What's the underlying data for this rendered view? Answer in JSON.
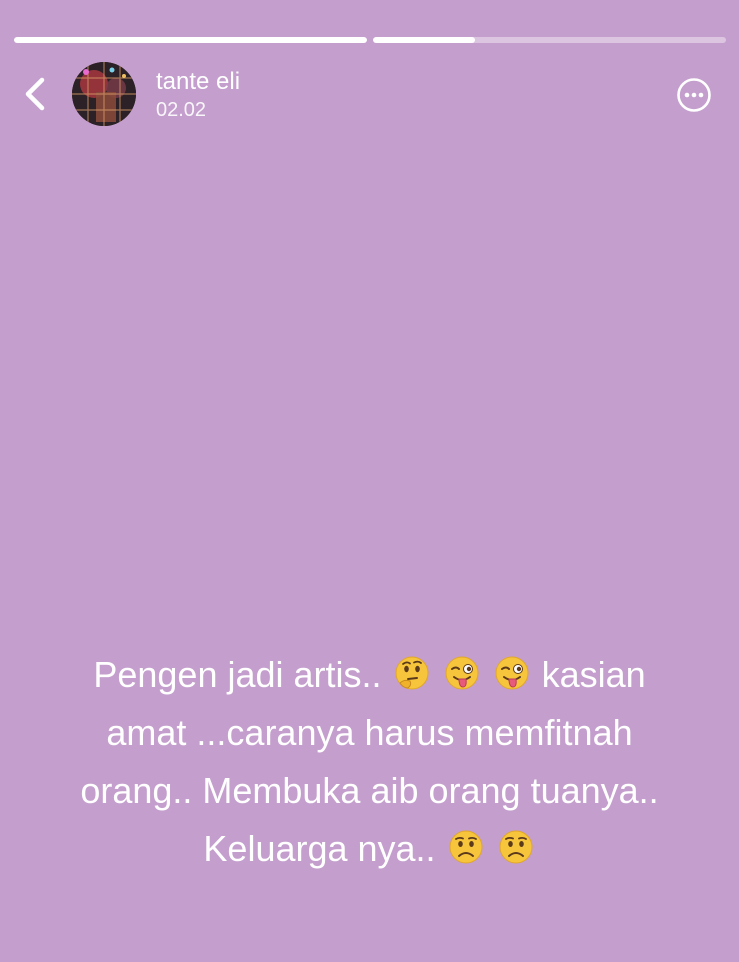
{
  "progress": [
    {
      "state": "complete",
      "fraction": 1.0
    },
    {
      "state": "active",
      "fraction": 0.29
    }
  ],
  "header": {
    "back_icon": "chevron-left-icon",
    "username": "tante eli",
    "timestamp": "02.02",
    "more_icon": "more-horizontal-circle-icon"
  },
  "story": {
    "line1_a": "Pengen jadi artis.. ",
    "line1_b": "kasian",
    "line2": "amat ...caranya harus memfitnah",
    "line3": "orang.. Membuka aib orang tuanya..",
    "line4": "Keluarga nya.. ",
    "emojis": [
      "thinking-face",
      "winking-tongue-face",
      "winking-tongue-face",
      "worried-face",
      "worried-face"
    ]
  },
  "colors": {
    "background": "#c49fcd",
    "text": "#ffffff"
  }
}
